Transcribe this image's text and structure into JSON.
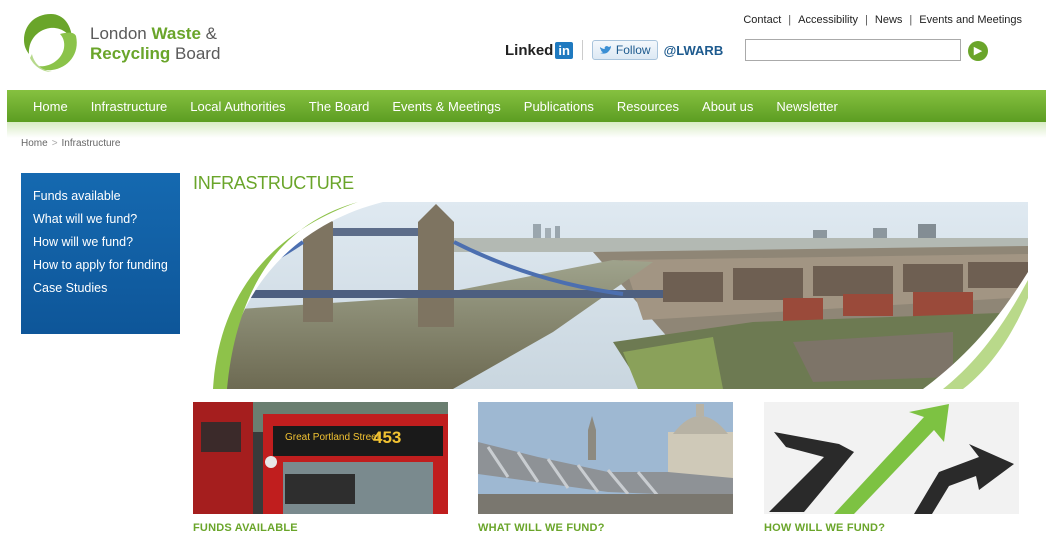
{
  "brand": {
    "line1_prefix": "London ",
    "line1_strong": "Waste",
    "line1_suffix": " &",
    "line2_strong": "Recycling",
    "line2_suffix": " Board",
    "green": "#6aa52a",
    "blue": "#1569b0"
  },
  "top_links": [
    "Contact",
    "Accessibility",
    "News",
    "Events and Meetings"
  ],
  "social": {
    "linkedin_word": "Linked",
    "linkedin_in": "in",
    "follow_label": "Follow",
    "handle": "@LWARB"
  },
  "search": {
    "placeholder": "",
    "button_icon": "arrow-right-icon"
  },
  "nav": [
    "Home",
    "Infrastructure",
    "Local Authorities",
    "The Board",
    "Events & Meetings",
    "Publications",
    "Resources",
    "About us",
    "Newsletter"
  ],
  "breadcrumb": [
    "Home",
    "Infrastructure"
  ],
  "sidebar": [
    "Funds available",
    "What will we fund?",
    "How will we fund?",
    "How to apply for funding",
    "Case Studies"
  ],
  "page_title": "INFRASTRUCTURE",
  "bus": {
    "destination": "Great Portland Street",
    "route": "453"
  },
  "tiles": [
    "FUNDS AVAILABLE",
    "WHAT WILL WE FUND?",
    "HOW WILL WE FUND?"
  ]
}
